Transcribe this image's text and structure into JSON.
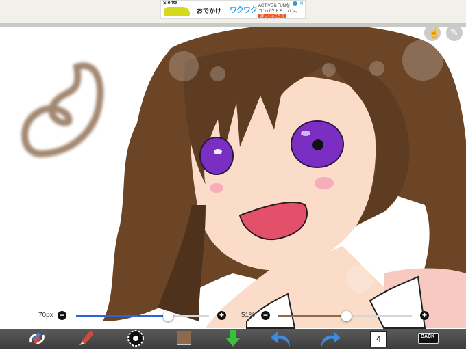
{
  "ad": {
    "brand": "Sienta",
    "headline": "おでかけ",
    "logo": "ワクワク",
    "sub_line1": "ACTIVE＆FUNな",
    "sub_line2": "コンパクトミニバン。",
    "cta": "詳しくはこちら"
  },
  "canvas": {
    "background": "#ffffff",
    "hair_color": "#6b4526",
    "skin_color": "#fadcc8",
    "eye_color": "#7b2fc2",
    "mouth_color": "#e3506a"
  },
  "brush_size": {
    "label": "70px",
    "value": 70,
    "fill_fraction": 0.69,
    "track_color": "#2d63d6"
  },
  "opacity": {
    "label": "51%",
    "value": 51,
    "fill_fraction": 0.51,
    "track_color": "#8d6a4e"
  },
  "controls": {
    "minus": "−",
    "plus": "+"
  },
  "toolbar": {
    "layer_count": "4",
    "back_label": "BACK",
    "current_color": "#8d6a4e"
  },
  "icons": [
    "hand-icon",
    "pencil-icon",
    "swap-tools-icon",
    "brush-icon",
    "color-wheel-icon",
    "color-swatch-icon",
    "save-icon",
    "undo-icon",
    "redo-icon",
    "layers-icon",
    "back-icon"
  ]
}
